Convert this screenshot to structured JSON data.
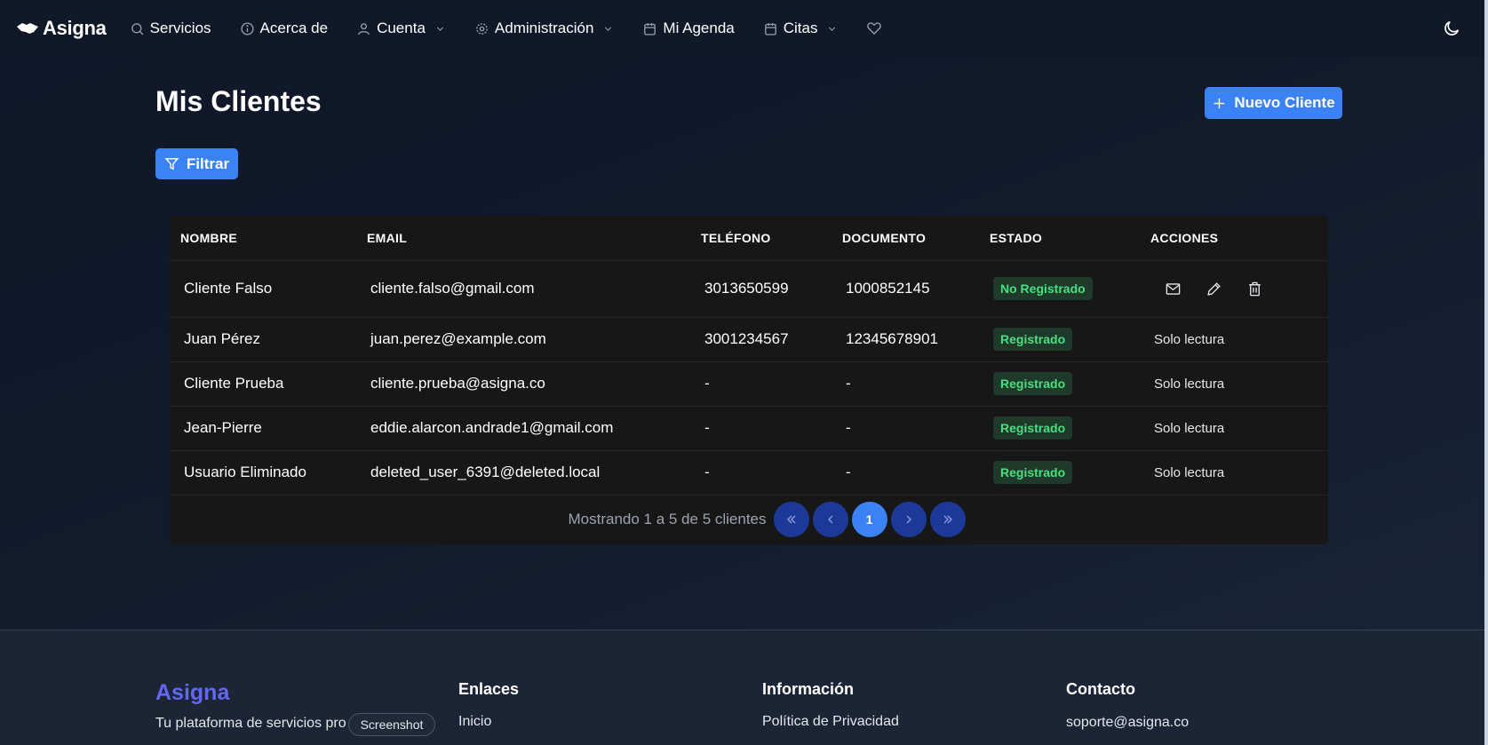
{
  "nav": {
    "brand": "Asigna",
    "items": [
      {
        "label": "Servicios",
        "icon": "search-icon"
      },
      {
        "label": "Acerca de",
        "icon": "info-icon"
      },
      {
        "label": "Cuenta",
        "icon": "user-icon"
      },
      {
        "label": "Administración",
        "icon": "gear-icon"
      },
      {
        "label": "Mi Agenda",
        "icon": "calendar-icon"
      },
      {
        "label": "Citas",
        "icon": "calendar-icon"
      }
    ]
  },
  "page": {
    "title": "Mis Clientes",
    "new_button": "Nuevo Cliente",
    "filter_button": "Filtrar"
  },
  "table": {
    "headers": [
      "NOMBRE",
      "EMAIL",
      "TELÉFONO",
      "DOCUMENTO",
      "ESTADO",
      "ACCIONES"
    ],
    "rows": [
      {
        "nombre": "Cliente Falso",
        "email": "cliente.falso@gmail.com",
        "telefono": "3013650599",
        "documento": "1000852145",
        "estado": "No Registrado",
        "acciones": ""
      },
      {
        "nombre": "Juan Pérez",
        "email": "juan.perez@example.com",
        "telefono": "3001234567",
        "documento": "12345678901",
        "estado": "Registrado",
        "acciones": "Solo lectura"
      },
      {
        "nombre": "Cliente Prueba",
        "email": "cliente.prueba@asigna.co",
        "telefono": "-",
        "documento": "-",
        "estado": "Registrado",
        "acciones": "Solo lectura"
      },
      {
        "nombre": "Jean-Pierre",
        "email": "eddie.alarcon.andrade1@gmail.com",
        "telefono": "-",
        "documento": "-",
        "estado": "Registrado",
        "acciones": "Solo lectura"
      },
      {
        "nombre": "Usuario Eliminado",
        "email": "deleted_user_6391@deleted.local",
        "telefono": "-",
        "documento": "-",
        "estado": "Registrado",
        "acciones": "Solo lectura"
      }
    ],
    "pagination": {
      "summary": "Mostrando 1 a 5 de 5 clientes",
      "current_page": "1"
    }
  },
  "footer": {
    "brand": "Asigna",
    "tagline": "Tu plataforma de servicios pro",
    "col_links_title": "Enlaces",
    "links": [
      "Inicio"
    ],
    "col_info_title": "Información",
    "info_links": [
      "Política de Privacidad"
    ],
    "col_contact_title": "Contacto",
    "contact_email": "soporte@asigna.co"
  },
  "tooltip": "Screenshot",
  "colors": {
    "accent": "#3b82f6",
    "badge_green": "#4ade80",
    "brand_footer": "#6366f1"
  }
}
